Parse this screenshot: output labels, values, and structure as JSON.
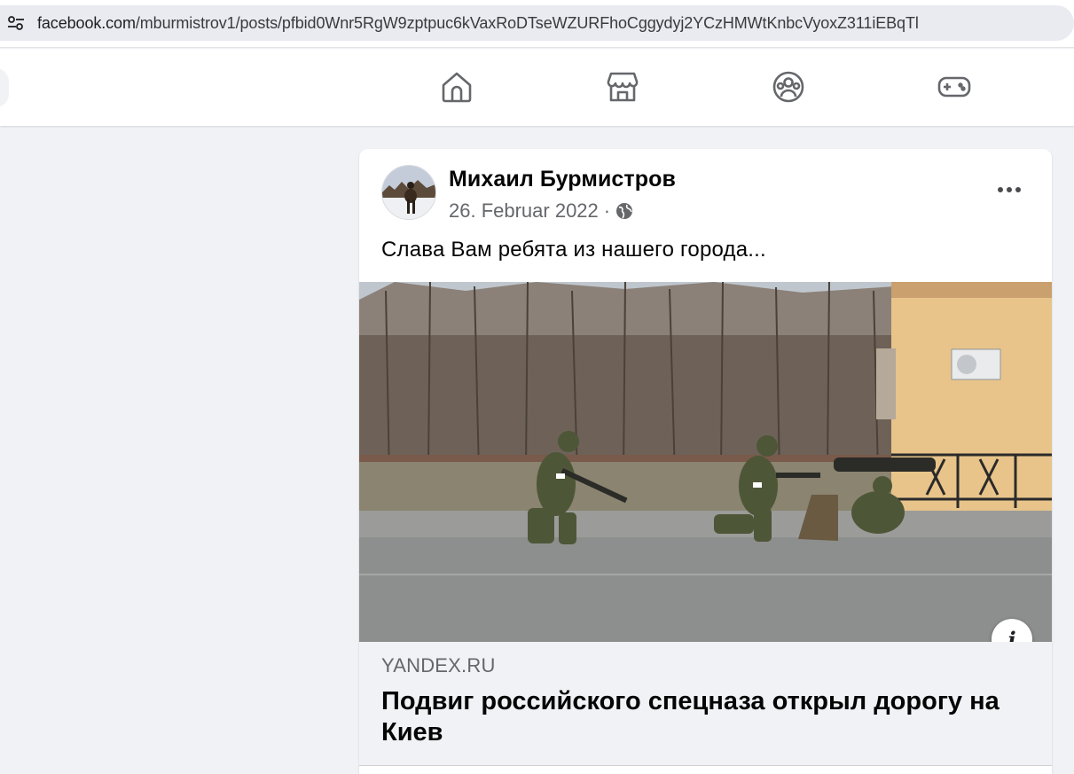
{
  "browser": {
    "url_domain": "facebook.com",
    "url_path": "/mburmistrov1/posts/pfbid0Wnr5RgW9zptpuc6kVaxRoDTseWZURFhoCggydyj2YCzHMWtKnbcVyoxZ311iEBqTl",
    "site_icon": "tune-icon"
  },
  "nav": {
    "icons": [
      "home-icon",
      "marketplace-icon",
      "groups-icon",
      "gaming-icon"
    ],
    "icon_color": "#65676b"
  },
  "post": {
    "author": "Михаил Бурмистров",
    "date": "26. Februar 2022",
    "separator": "·",
    "privacy_icon": "globe-icon",
    "text": "Слава Вам ребята из нашего города...",
    "link": {
      "domain": "YANDEX.RU",
      "title": "Подвиг российского спецназа открыл дорогу на Киев"
    },
    "info_label": "i"
  },
  "colors": {
    "background": "#f0f2f5",
    "card": "#ffffff",
    "secondary_text": "#65676b",
    "primary_text": "#050505"
  }
}
